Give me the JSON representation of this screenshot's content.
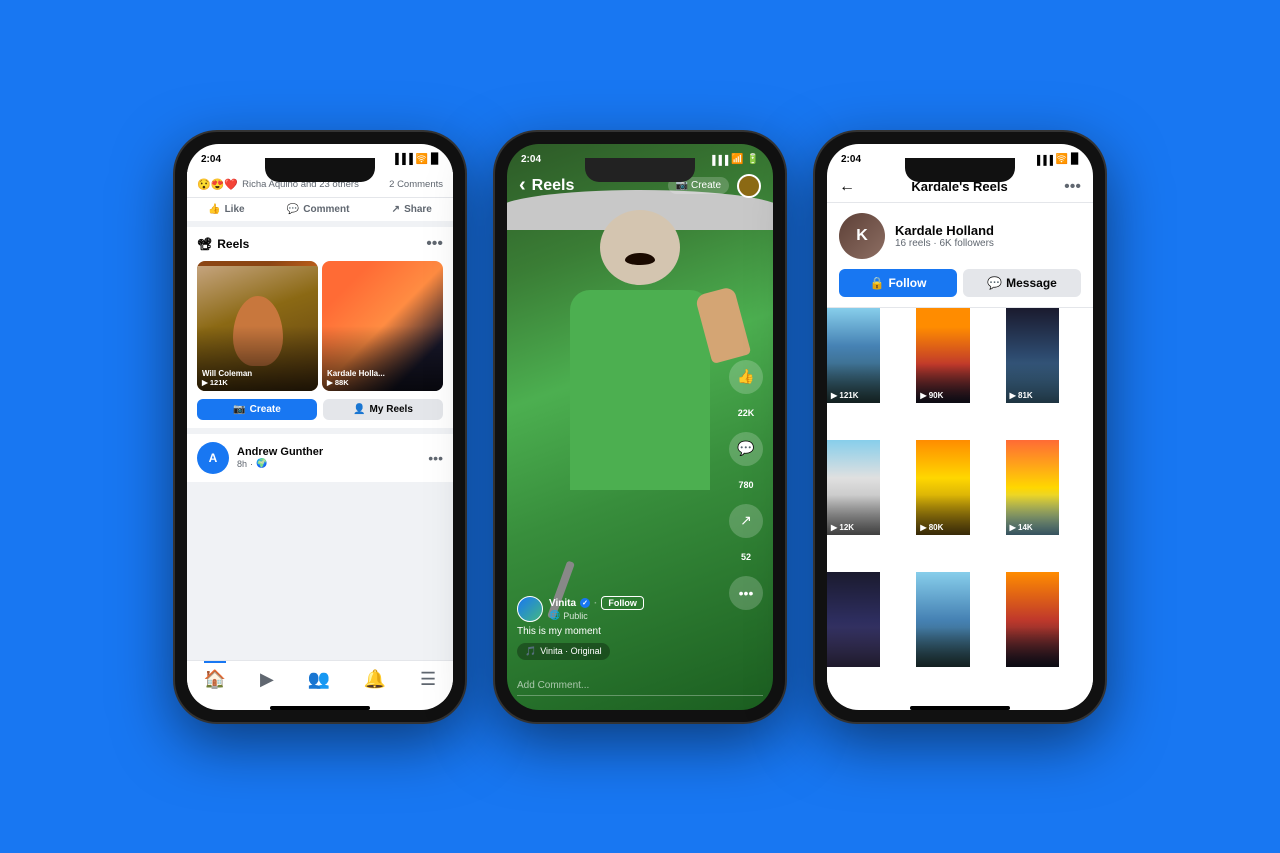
{
  "background": {
    "color": "#1877F2"
  },
  "phone1": {
    "status_time": "2:04",
    "reaction_text": "Richa Aquino and 23 others",
    "comments_text": "2 Comments",
    "like_label": "Like",
    "comment_label": "Comment",
    "share_label": "Share",
    "reels_section_title": "Reels",
    "reel1_creator": "Will Coleman",
    "reel1_views": "▶ 121K",
    "reel2_creator": "Kardale Holla...",
    "reel2_views": "▶ 88K",
    "create_btn": "Create",
    "myreels_btn": "My Reels",
    "post_name": "Andrew Gunther",
    "post_time": "8h",
    "post_privacy": "🌍",
    "dots_icon": "•••",
    "nav_home": "🏠",
    "nav_video": "▶",
    "nav_groups": "👥",
    "nav_bell": "🔔",
    "nav_menu": "☰"
  },
  "phone2": {
    "status_time": "2:04",
    "back_label": "‹",
    "reels_title": "Reels",
    "create_label": "Create",
    "creator_name": "Vinita",
    "creator_verified": "✓",
    "follow_label": "Follow",
    "creator_sub": "Public",
    "caption": "This is my moment",
    "music_label": "Vinita · Original",
    "like_count": "22K",
    "comment_count": "780",
    "share_count": "52",
    "comment_placeholder": "Add Comment...",
    "dots_label": "•••"
  },
  "phone3": {
    "status_time": "2:04",
    "page_title": "Kardale's Reels",
    "creator_name": "Kardale Holland",
    "creator_meta": "16 reels · 6K followers",
    "follow_label": "Follow",
    "message_label": "Message",
    "thumbs": [
      {
        "views": "▶ 121K",
        "class": "gt1"
      },
      {
        "views": "▶ 90K",
        "class": "gt2"
      },
      {
        "views": "▶ 81K",
        "class": "gt3"
      },
      {
        "views": "▶ 12K",
        "class": "gt4"
      },
      {
        "views": "▶ 80K",
        "class": "gt5"
      },
      {
        "views": "▶ 14K",
        "class": "gt6"
      },
      {
        "views": "",
        "class": "gt7"
      },
      {
        "views": "",
        "class": "gt8"
      },
      {
        "views": "",
        "class": "gt9"
      }
    ]
  }
}
